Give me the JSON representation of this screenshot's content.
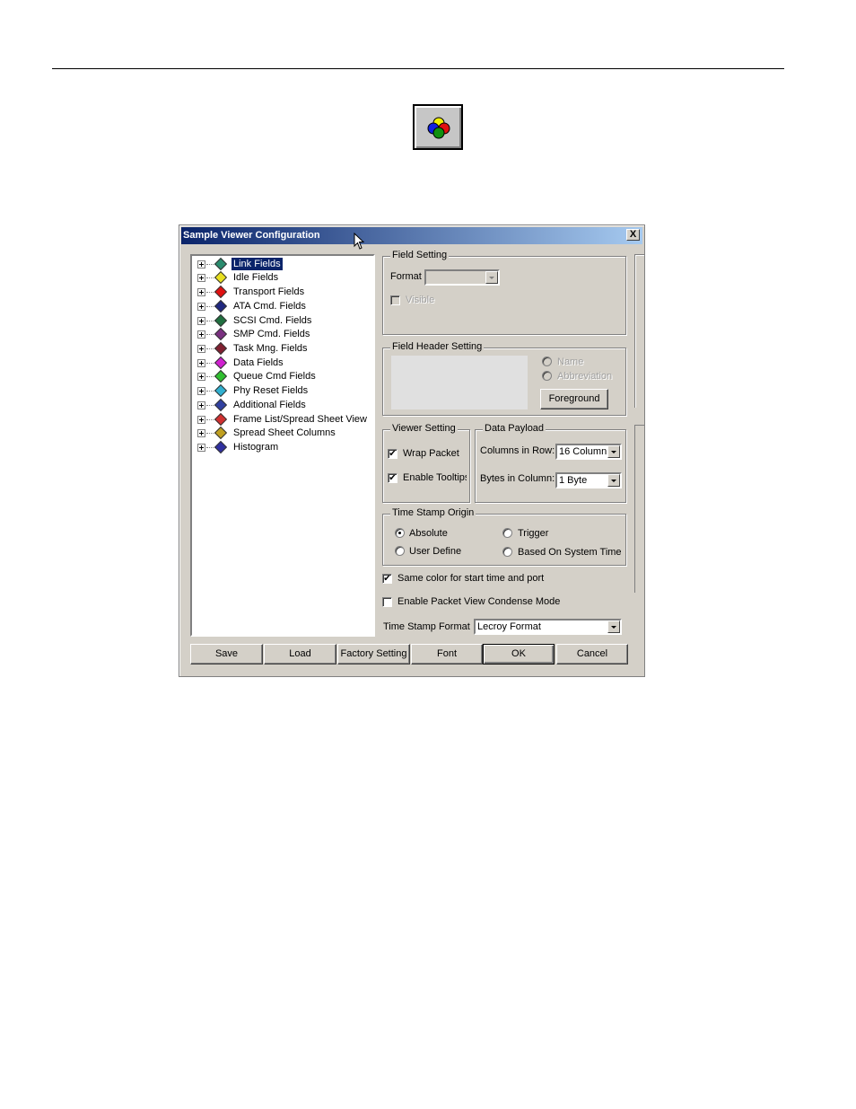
{
  "dialog": {
    "title": "Sample Viewer Configuration",
    "close_label": "X",
    "tree": [
      {
        "label": "Link Fields",
        "selected": true,
        "icon": "green-gem-icon",
        "color": "#2a8c6e"
      },
      {
        "label": "Idle Fields",
        "icon": "yellow-gem-icon",
        "color": "#e8e020"
      },
      {
        "label": "Transport Fields",
        "icon": "red-gem-icon",
        "color": "#e01010"
      },
      {
        "label": "ATA Cmd. Fields",
        "icon": "navy-gem-icon",
        "color": "#202880"
      },
      {
        "label": "SCSI Cmd. Fields",
        "icon": "darkgreen-gem-icon",
        "color": "#207040"
      },
      {
        "label": "SMP Cmd. Fields",
        "icon": "purple-gem-icon",
        "color": "#7a3080"
      },
      {
        "label": "Task Mng. Fields",
        "icon": "maroon-gem-icon",
        "color": "#802030"
      },
      {
        "label": "Data Fields",
        "icon": "magenta-gem-icon",
        "color": "#d020d0"
      },
      {
        "label": "Queue Cmd Fields",
        "icon": "lime-gem-icon",
        "color": "#30c030"
      },
      {
        "label": "Phy Reset Fields",
        "icon": "cyan-gem-icon",
        "color": "#30b0d0"
      },
      {
        "label": "Additional Fields",
        "icon": "heart-icon",
        "color": "#3040a0"
      },
      {
        "label": "Frame List/Spread Sheet View",
        "icon": "eraser-icon",
        "color": "#d03030"
      },
      {
        "label": "Spread Sheet Columns",
        "icon": "grid-icon",
        "color": "#c0a020"
      },
      {
        "label": "Histogram",
        "icon": "histogram-icon",
        "color": "#3030a0"
      }
    ],
    "field_setting": {
      "caption": "Field Setting",
      "format_label": "Format",
      "format_value": "",
      "visible_label": "Visible"
    },
    "field_header": {
      "caption": "Field Header Setting",
      "name_label": "Name",
      "abbreviation_label": "Abbreviation",
      "foreground_label": "Foreground"
    },
    "viewer_setting": {
      "caption": "Viewer Setting",
      "wrap_packet_label": "Wrap Packet",
      "enable_tooltips_label": "Enable Tooltips"
    },
    "data_payload": {
      "caption": "Data Payload",
      "columns_label": "Columns in Row:",
      "columns_value": "16  Column",
      "bytes_label": "Bytes in Column:",
      "bytes_value": "1  Byte"
    },
    "time_stamp_origin": {
      "caption": "Time Stamp Origin",
      "absolute_label": "Absolute",
      "trigger_label": "Trigger",
      "user_define_label": "User Define",
      "system_time_label": "Based On System Time"
    },
    "same_color_label": "Same color for start time and port",
    "condense_label": "Enable Packet View Condense Mode",
    "ts_format_label": "Time Stamp Format",
    "ts_format_value": "Lecroy Format",
    "buttons": {
      "save": "Save",
      "load": "Load",
      "factory": "Factory Setting",
      "font": "Font",
      "ok": "OK",
      "cancel": "Cancel"
    }
  }
}
